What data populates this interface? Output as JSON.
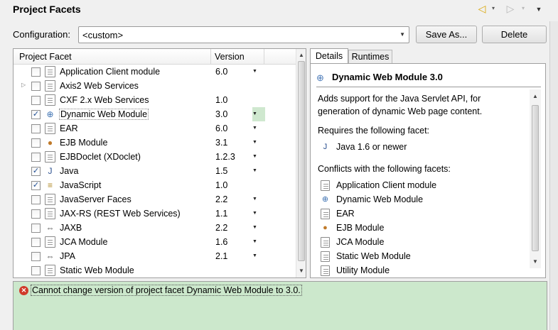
{
  "window": {
    "title": "Project Facets"
  },
  "nav": {
    "back_icon": "◁",
    "forward_icon": "▷",
    "dropdown_icon": "▾",
    "menu_icon": "▼"
  },
  "configuration": {
    "label": "Configuration:",
    "value": "<custom>",
    "save_as_label": "Save As...",
    "delete_label": "Delete"
  },
  "facet_table": {
    "headers": [
      "Project Facet",
      "Version"
    ],
    "rows": [
      {
        "name": "Application Client module",
        "version": "6.0",
        "checked": false,
        "icon": "document-icon",
        "has_dropdown": true,
        "expandable": false
      },
      {
        "name": "Axis2 Web Services",
        "version": "",
        "checked": false,
        "icon": "document-icon",
        "has_dropdown": false,
        "expandable": true
      },
      {
        "name": "CXF 2.x Web Services",
        "version": "1.0",
        "checked": false,
        "icon": "document-icon",
        "has_dropdown": false,
        "expandable": false
      },
      {
        "name": "Dynamic Web Module",
        "version": "3.0",
        "checked": true,
        "icon": "globe-icon",
        "has_dropdown": true,
        "expandable": false,
        "selected": true
      },
      {
        "name": "EAR",
        "version": "6.0",
        "checked": false,
        "icon": "document-icon",
        "has_dropdown": true,
        "expandable": false
      },
      {
        "name": "EJB Module",
        "version": "3.1",
        "checked": false,
        "icon": "bean-icon",
        "has_dropdown": true,
        "expandable": false
      },
      {
        "name": "EJBDoclet (XDoclet)",
        "version": "1.2.3",
        "checked": false,
        "icon": "document-icon",
        "has_dropdown": true,
        "expandable": false
      },
      {
        "name": "Java",
        "version": "1.5",
        "checked": true,
        "icon": "java-icon",
        "has_dropdown": true,
        "expandable": false
      },
      {
        "name": "JavaScript",
        "version": "1.0",
        "checked": true,
        "icon": "script-icon",
        "has_dropdown": false,
        "expandable": false
      },
      {
        "name": "JavaServer Faces",
        "version": "2.2",
        "checked": false,
        "icon": "document-icon",
        "has_dropdown": true,
        "expandable": false
      },
      {
        "name": "JAX-RS (REST Web Services)",
        "version": "1.1",
        "checked": false,
        "icon": "document-icon",
        "has_dropdown": true,
        "expandable": false
      },
      {
        "name": "JAXB",
        "version": "2.2",
        "checked": false,
        "icon": "arrows-icon",
        "has_dropdown": true,
        "expandable": false
      },
      {
        "name": "JCA Module",
        "version": "1.6",
        "checked": false,
        "icon": "document-icon",
        "has_dropdown": true,
        "expandable": false
      },
      {
        "name": "JPA",
        "version": "2.1",
        "checked": false,
        "icon": "arrows-icon",
        "has_dropdown": true,
        "expandable": false
      },
      {
        "name": "Static Web Module",
        "version": "",
        "checked": false,
        "icon": "document-icon",
        "has_dropdown": false,
        "expandable": false
      }
    ]
  },
  "tabs": {
    "details": "Details",
    "runtimes": "Runtimes"
  },
  "details": {
    "title": "Dynamic Web Module 3.0",
    "description_line1": "Adds support for the Java Servlet API, for",
    "description_line2": "generation of dynamic Web page content.",
    "requires_label": "Requires the following facet:",
    "requires": [
      {
        "label": "Java 1.6 or newer",
        "icon": "java-icon"
      }
    ],
    "conflicts_label": "Conflicts with the following facets:",
    "conflicts": [
      {
        "label": "Application Client module",
        "icon": "document-icon"
      },
      {
        "label": "Dynamic Web Module",
        "icon": "globe-icon"
      },
      {
        "label": "EAR",
        "icon": "document-icon"
      },
      {
        "label": "EJB Module",
        "icon": "bean-icon"
      },
      {
        "label": "JCA Module",
        "icon": "document-icon"
      },
      {
        "label": "Static Web Module",
        "icon": "document-icon"
      },
      {
        "label": "Utility Module",
        "icon": "document-icon"
      }
    ]
  },
  "error": {
    "message": "Cannot change version of project facet Dynamic Web Module to 3.0.",
    "icon": "error-icon"
  },
  "colors": {
    "error_bg": "#cce8cc",
    "selected_version_bg": "#cfe8cf",
    "error_icon": "#d03a2a"
  }
}
